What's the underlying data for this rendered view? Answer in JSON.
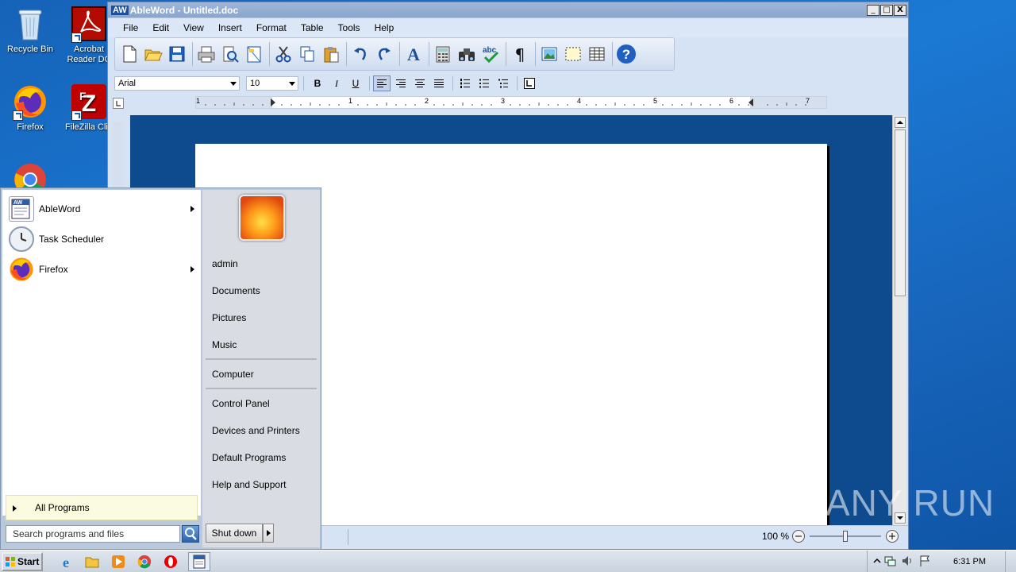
{
  "desktop": {
    "icons": [
      {
        "label": "Recycle Bin"
      },
      {
        "label": "Acrobat Reader DC"
      },
      {
        "label": "Firefox"
      },
      {
        "label": "FileZilla Clie"
      },
      {
        "label": ""
      }
    ]
  },
  "window": {
    "title": "AbleWord - Untitled.doc",
    "logo_text": "AW",
    "controls": {
      "minimize": "_",
      "maximize": "□",
      "close": "X"
    },
    "menu": [
      "File",
      "Edit",
      "View",
      "Insert",
      "Format",
      "Table",
      "Tools",
      "Help"
    ],
    "font_name": "Arial",
    "font_size": "10",
    "format_buttons": {
      "bold": "B",
      "italic": "I",
      "underline": "U"
    },
    "ruler_numbers": [
      "1",
      "1",
      "2",
      "3",
      "4",
      "5",
      "6",
      "7"
    ],
    "zoom": "100 %"
  },
  "start_menu": {
    "pinned": [
      {
        "label": "AbleWord",
        "has_submenu": true
      },
      {
        "label": "Task Scheduler",
        "has_submenu": false
      },
      {
        "label": "Firefox",
        "has_submenu": true
      }
    ],
    "all_programs": "All Programs",
    "search_placeholder": "Search programs and files",
    "right_links": [
      "admin",
      "Documents",
      "Pictures",
      "Music",
      "Computer",
      "Control Panel",
      "Devices and Printers",
      "Default Programs",
      "Help and Support"
    ],
    "shutdown": "Shut down"
  },
  "taskbar": {
    "start_label": "Start",
    "clock": "6:31 PM"
  },
  "watermark": "ANY RUN",
  "colors": {
    "desktop": "#1a6fc8",
    "doc_background": "#0e4a8e",
    "accent": "#2a62b0"
  }
}
